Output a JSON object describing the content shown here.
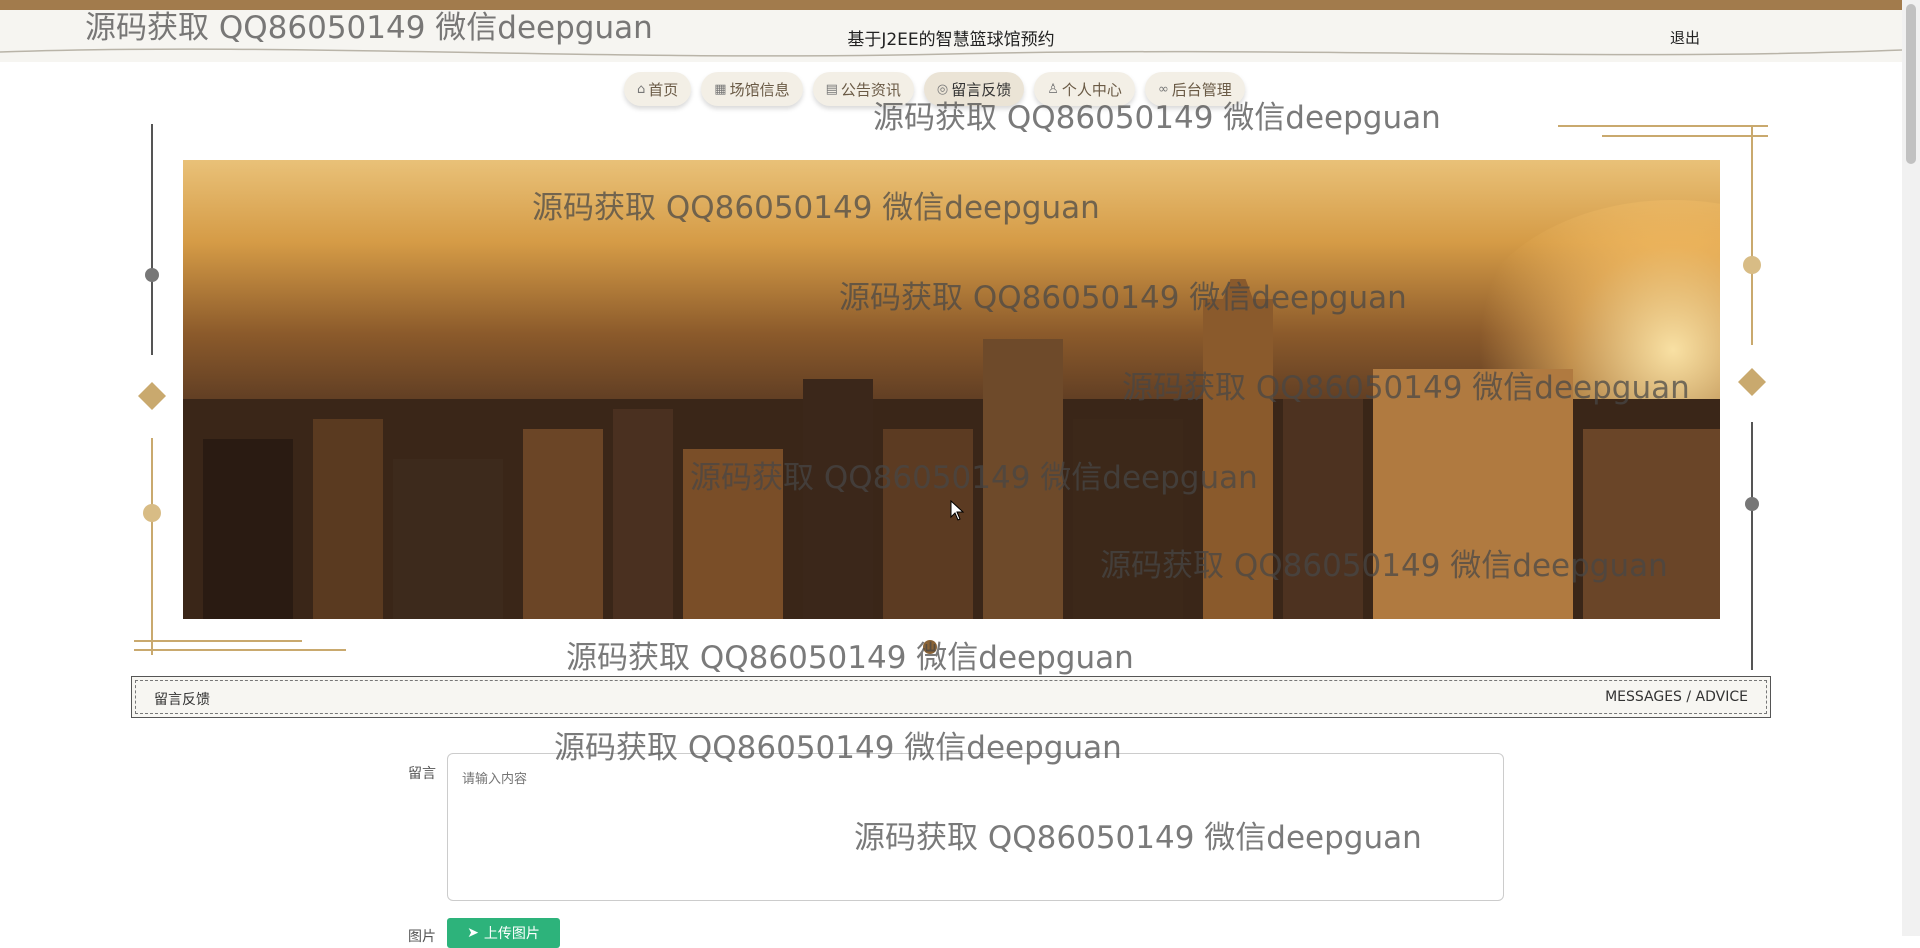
{
  "header": {
    "title": "基于J2EE的智慧篮球馆预约",
    "logout": "退出"
  },
  "nav": {
    "items": [
      {
        "label": "首页",
        "icon": "home-icon"
      },
      {
        "label": "场馆信息",
        "icon": "grid-icon"
      },
      {
        "label": "公告资讯",
        "icon": "document-icon"
      },
      {
        "label": "留言反馈",
        "icon": "message-icon"
      },
      {
        "label": "个人中心",
        "icon": "user-icon"
      },
      {
        "label": "后台管理",
        "icon": "link-icon"
      }
    ],
    "active": "留言反馈"
  },
  "section": {
    "title": "留言反馈",
    "subtitle": "MESSAGES / ADVICE"
  },
  "form": {
    "message_label": "留言",
    "message_placeholder": "请输入内容",
    "image_label": "图片",
    "upload_label": "上传图片"
  },
  "watermark": "源码获取 QQ86050149 微信deepguan",
  "colors": {
    "topbar": "#a27b4c",
    "accent_gold": "#c9a96e",
    "upload_green": "#2db37b"
  }
}
